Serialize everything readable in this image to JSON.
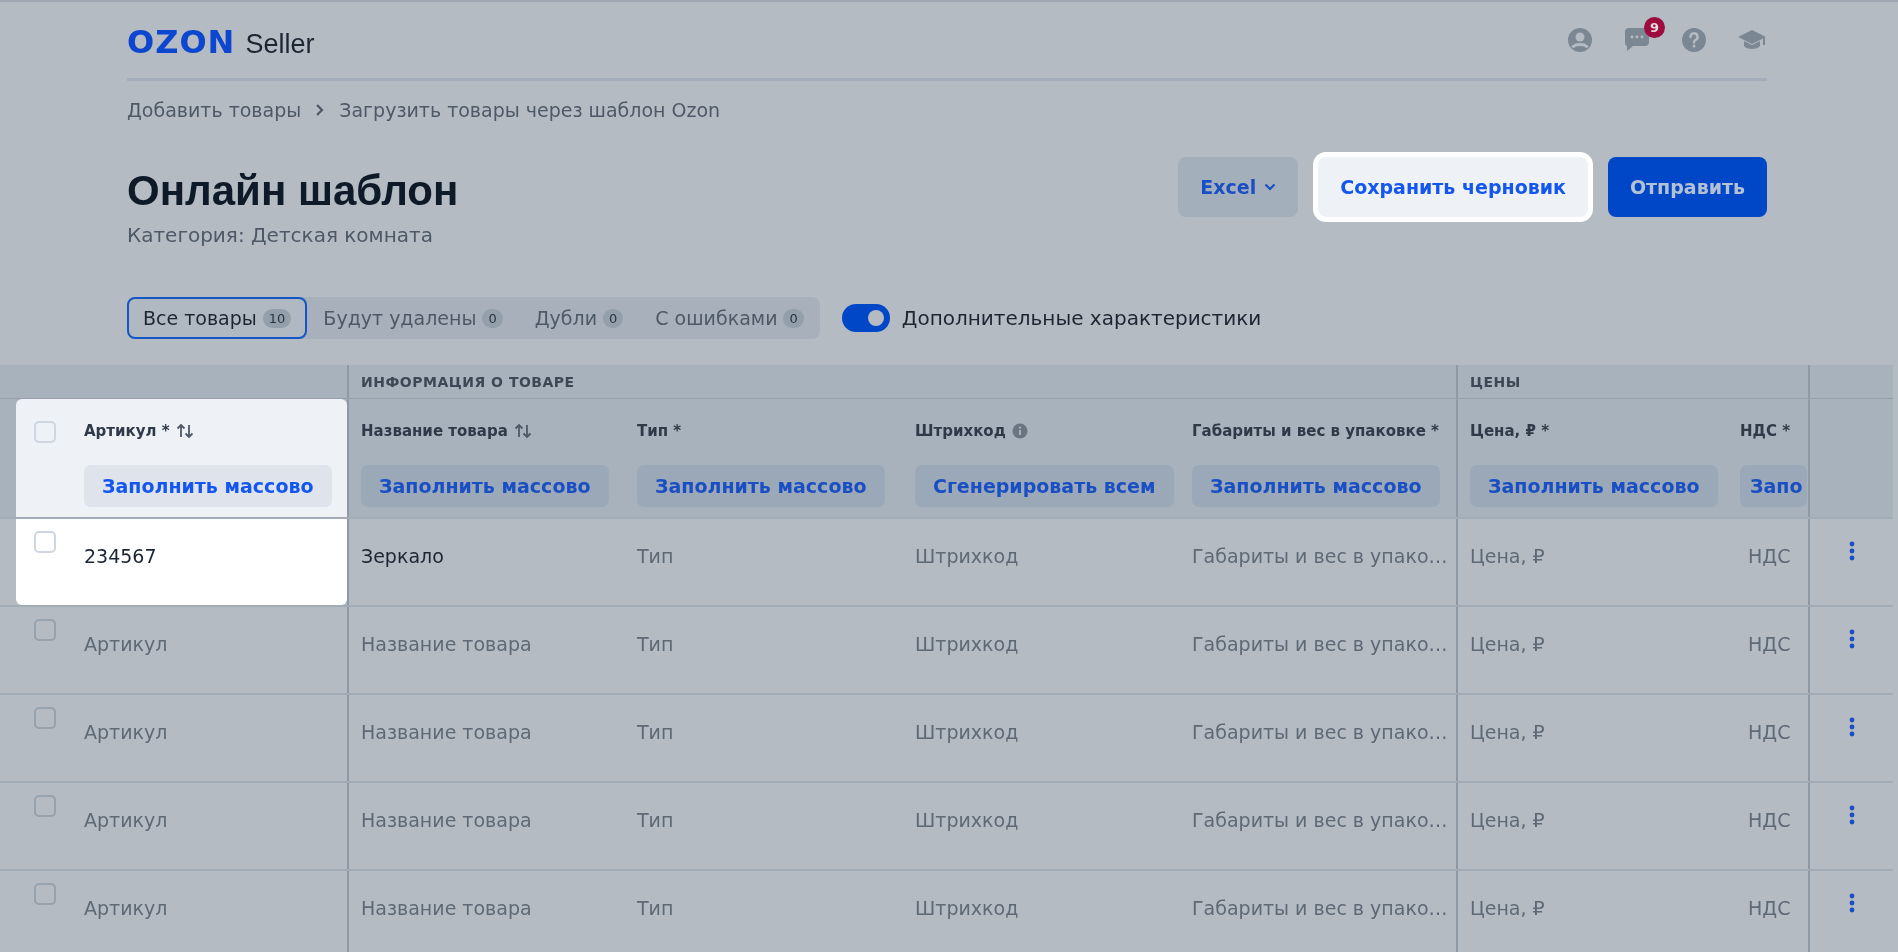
{
  "header": {
    "logo": "OZON",
    "product": "Seller",
    "notifications_badge": "9"
  },
  "breadcrumbs": [
    "Добавить товары",
    "Загрузить товары через шаблон Ozon"
  ],
  "title": "Онлайн шаблон",
  "subtitle": "Категория: Детская комната",
  "actions": [
    {
      "label": "Excel",
      "kind": "dropdown",
      "highlighted": false
    },
    {
      "label": "Сохранить черновик",
      "kind": "secondary",
      "highlighted": true
    },
    {
      "label": "Отправить",
      "kind": "primary",
      "highlighted": false
    }
  ],
  "tabs": [
    {
      "label": "Все товары",
      "count": "10",
      "selected": true
    },
    {
      "label": "Будут удалены",
      "count": "0",
      "selected": false
    },
    {
      "label": "Дубли",
      "count": "0",
      "selected": false
    },
    {
      "label": "С ошибками",
      "count": "0",
      "selected": false
    }
  ],
  "extra_toggle": {
    "label": "Дополнительные характеристики",
    "on": true
  },
  "table": {
    "groups": [
      {
        "label": "ИНФОРМАЦИЯ О ТОВАРЕ"
      },
      {
        "label": "ЦЕНЫ"
      }
    ],
    "select_all_checked": false,
    "columns": [
      {
        "label": "Артикул *",
        "sortable": true,
        "info": false,
        "button": "Заполнить массово",
        "highlighted": true
      },
      {
        "label": "Название товара",
        "sortable": true,
        "info": false,
        "button": "Заполнить массово",
        "highlighted": false
      },
      {
        "label": "Тип *",
        "sortable": false,
        "info": false,
        "button": "Заполнить массово",
        "highlighted": false
      },
      {
        "label": "Штрихкод",
        "sortable": false,
        "info": true,
        "button": "Сгенерировать всем",
        "highlighted": false
      },
      {
        "label": "Габариты и вес в упаковке *",
        "sortable": false,
        "info": false,
        "button": "Заполнить массово",
        "highlighted": false
      },
      {
        "label": "Цена, ₽ *",
        "sortable": false,
        "info": false,
        "button": "Заполнить массово",
        "highlighted": false
      },
      {
        "label": "НДС *",
        "sortable": false,
        "info": false,
        "button": "Запо",
        "highlighted": false
      }
    ],
    "rows": [
      {
        "checked": false,
        "highlighted": true,
        "cells": [
          {
            "value": "234567"
          },
          {
            "value": "Зеркало"
          },
          {
            "placeholder": "Тип"
          },
          {
            "placeholder": "Штрихкод"
          },
          {
            "placeholder": "Габариты и вес в упако…"
          },
          {
            "placeholder": "Цена, ₽"
          },
          {
            "placeholder": "НДС"
          }
        ]
      },
      {
        "checked": false,
        "highlighted": false,
        "cells": [
          {
            "placeholder": "Артикул"
          },
          {
            "placeholder": "Название товара"
          },
          {
            "placeholder": "Тип"
          },
          {
            "placeholder": "Штрихкод"
          },
          {
            "placeholder": "Габариты и вес в упако…"
          },
          {
            "placeholder": "Цена, ₽"
          },
          {
            "placeholder": "НДС"
          }
        ]
      },
      {
        "checked": false,
        "highlighted": false,
        "cells": [
          {
            "placeholder": "Артикул"
          },
          {
            "placeholder": "Название товара"
          },
          {
            "placeholder": "Тип"
          },
          {
            "placeholder": "Штрихкод"
          },
          {
            "placeholder": "Габариты и вес в упако…"
          },
          {
            "placeholder": "Цена, ₽"
          },
          {
            "placeholder": "НДС"
          }
        ]
      },
      {
        "checked": false,
        "highlighted": false,
        "cells": [
          {
            "placeholder": "Артикул"
          },
          {
            "placeholder": "Название товара"
          },
          {
            "placeholder": "Тип"
          },
          {
            "placeholder": "Штрихкод"
          },
          {
            "placeholder": "Габариты и вес в упако…"
          },
          {
            "placeholder": "Цена, ₽"
          },
          {
            "placeholder": "НДС"
          }
        ]
      },
      {
        "checked": false,
        "highlighted": false,
        "cells": [
          {
            "placeholder": "Артикул"
          },
          {
            "placeholder": "Название товара"
          },
          {
            "placeholder": "Тип"
          },
          {
            "placeholder": "Штрихкод"
          },
          {
            "placeholder": "Габариты и вес в упако…"
          },
          {
            "placeholder": "Цена, ₽"
          },
          {
            "placeholder": "НДС"
          }
        ]
      }
    ]
  }
}
